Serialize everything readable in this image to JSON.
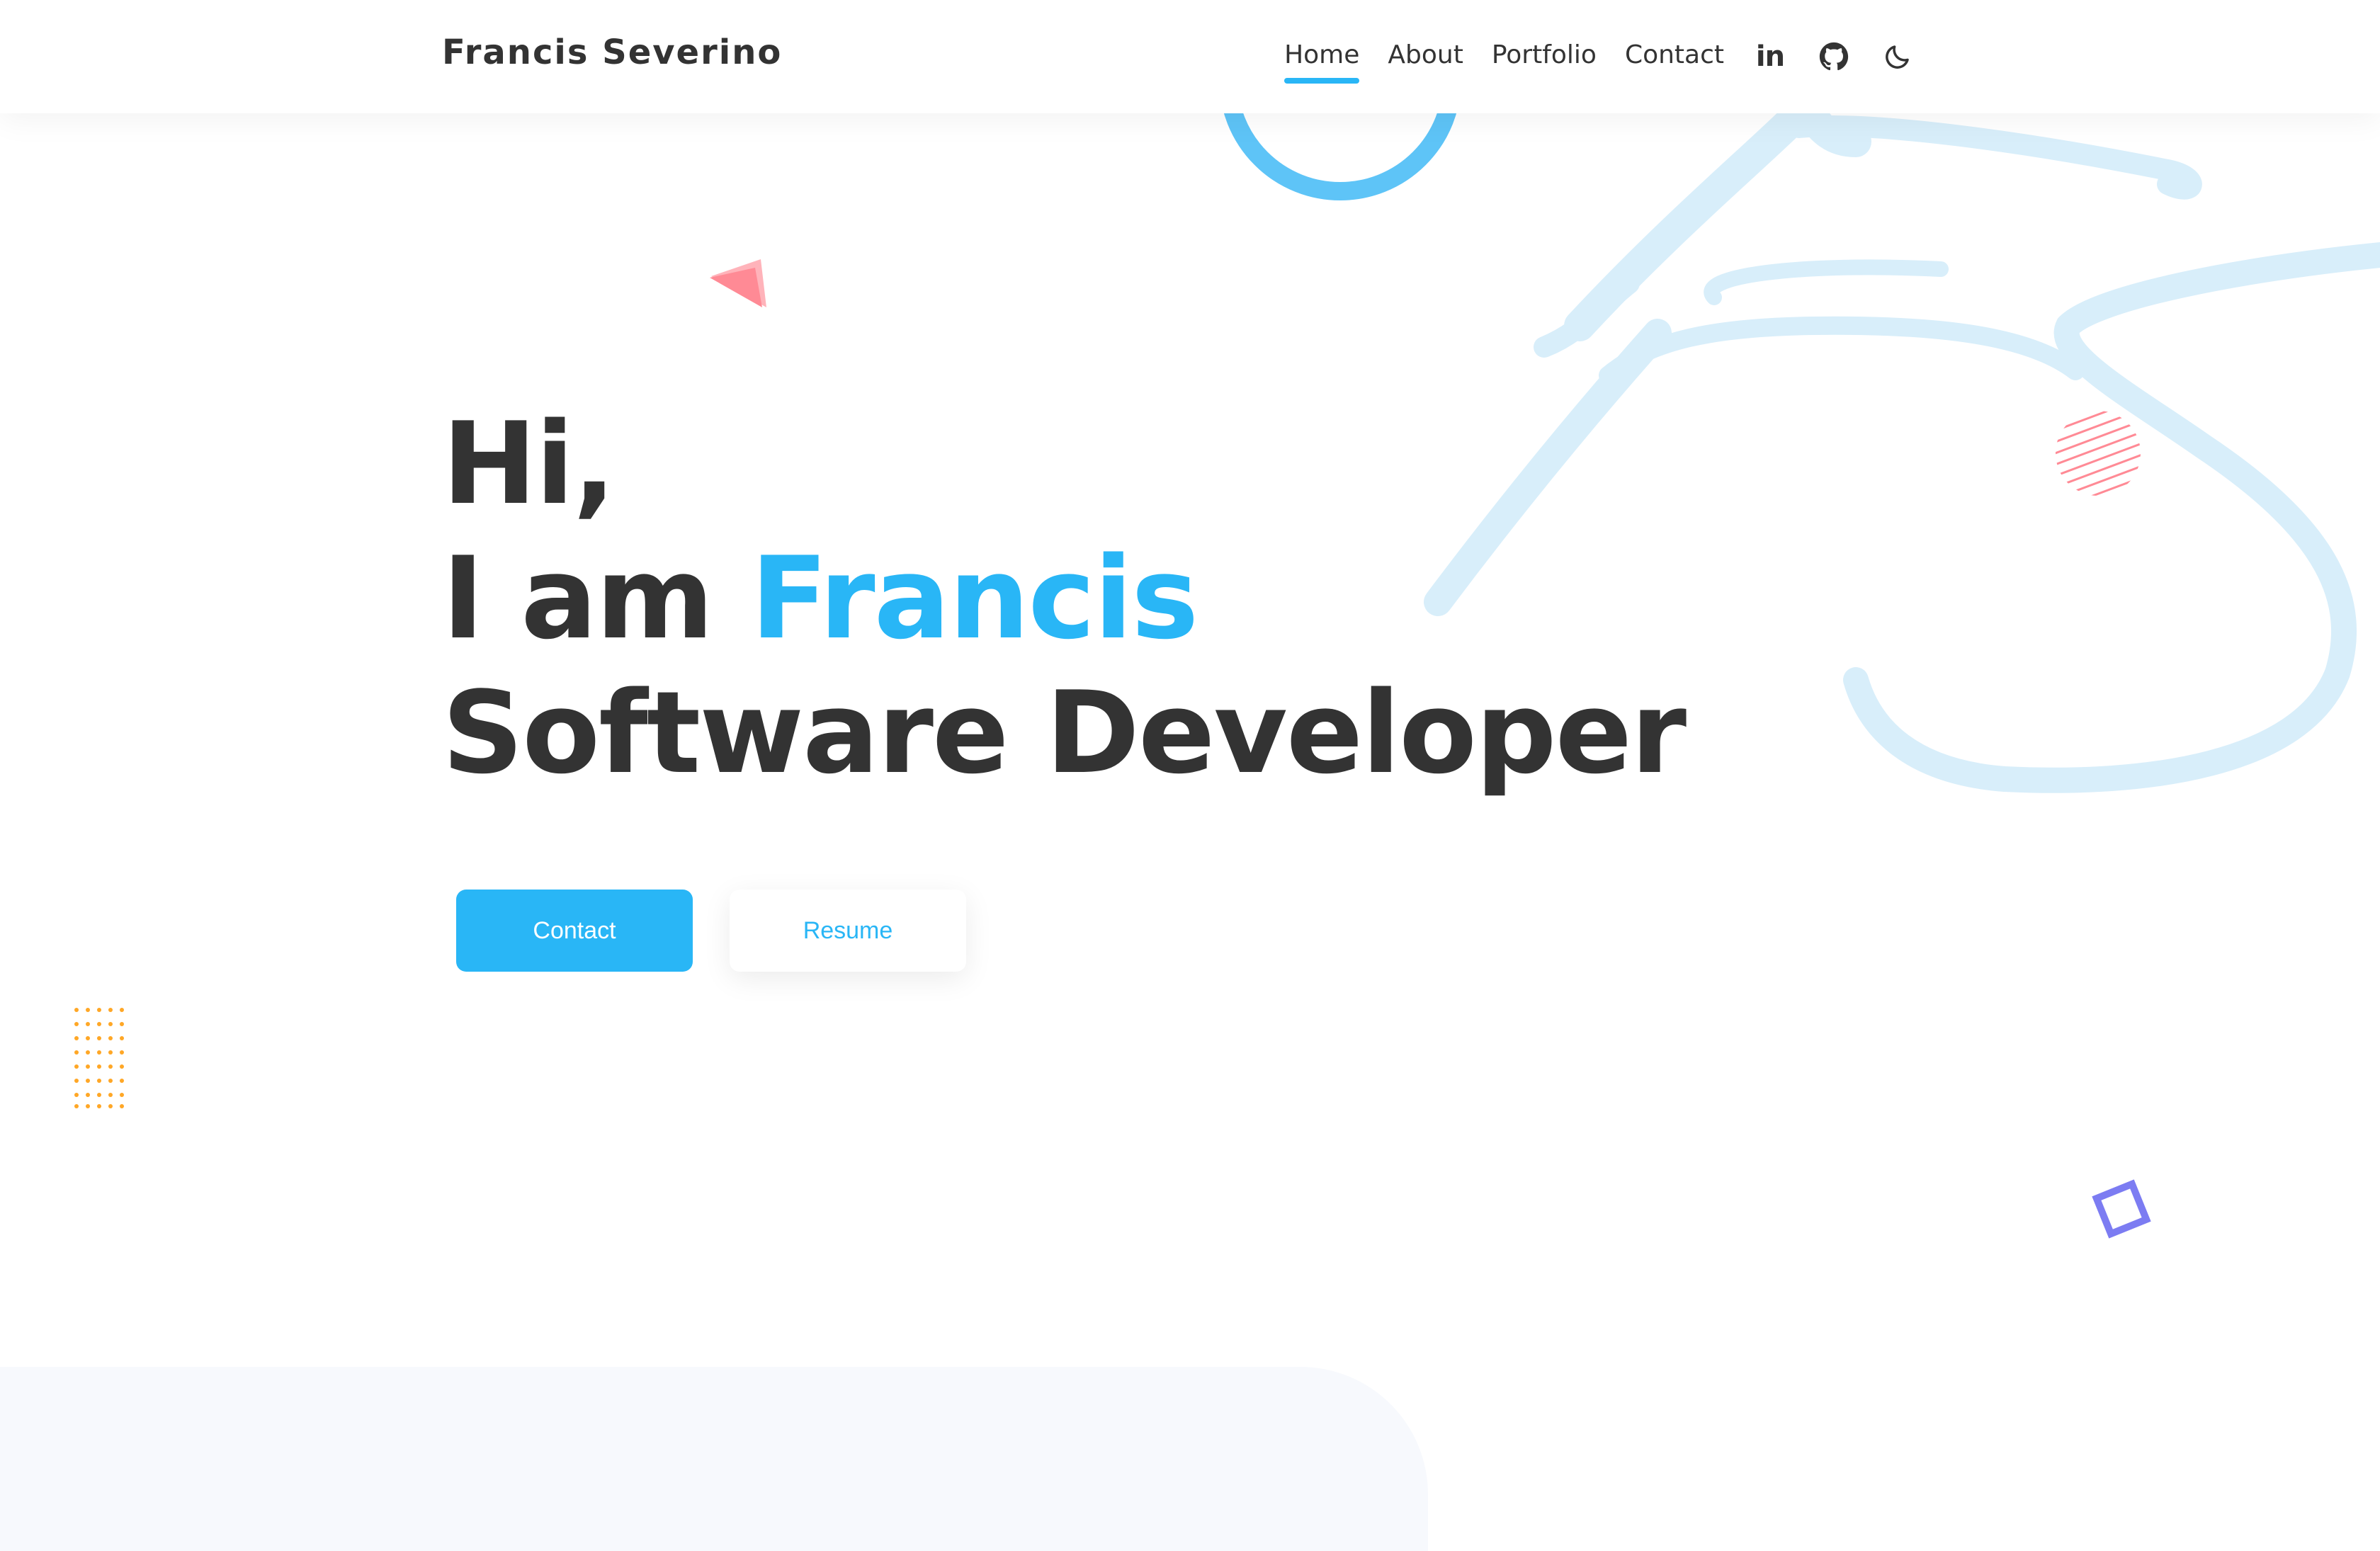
{
  "header": {
    "brand": "Francis Severino",
    "nav": [
      {
        "label": "Home",
        "active": true
      },
      {
        "label": "About",
        "active": false
      },
      {
        "label": "Portfolio",
        "active": false
      },
      {
        "label": "Contact",
        "active": false
      }
    ],
    "social": {
      "linkedin_label": "in",
      "icons": [
        "linkedin-icon",
        "github-icon",
        "moon-icon"
      ]
    }
  },
  "hero": {
    "line1": "Hi,",
    "line2_prefix": "I am ",
    "line2_name": "Francis",
    "line3": "Software Developer",
    "buttons": {
      "primary": "Contact",
      "secondary": "Resume"
    }
  },
  "colors": {
    "accent": "#29b6f6",
    "text": "#333333",
    "signature": "#d8eefa",
    "triangle": "#ff8a95",
    "dots": "#ffa726",
    "square": "#7c7cf2",
    "panel": "#f7f9fd"
  }
}
